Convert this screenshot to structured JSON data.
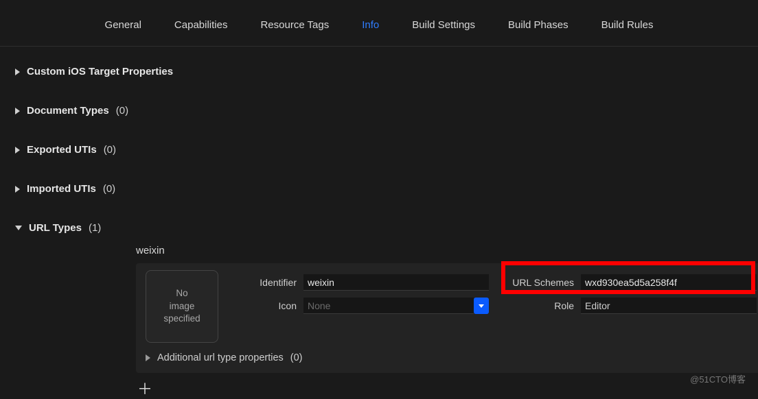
{
  "tabs": {
    "general": "General",
    "capabilities": "Capabilities",
    "resource_tags": "Resource Tags",
    "info": "Info",
    "build_settings": "Build Settings",
    "build_phases": "Build Phases",
    "build_rules": "Build Rules",
    "active": "info"
  },
  "sections": {
    "custom_props": {
      "label": "Custom iOS Target Properties"
    },
    "doc_types": {
      "label": "Document Types",
      "count": "(0)"
    },
    "exported_utis": {
      "label": "Exported UTIs",
      "count": "(0)"
    },
    "imported_utis": {
      "label": "Imported UTIs",
      "count": "(0)"
    },
    "url_types": {
      "label": "URL Types",
      "count": "(1)"
    }
  },
  "url_entry": {
    "name": "weixin",
    "img_well_text": "No\nimage\nspecified",
    "identifier_label": "Identifier",
    "identifier_value": "weixin",
    "icon_label": "Icon",
    "icon_value": "None",
    "url_schemes_label": "URL Schemes",
    "url_schemes_value": "wxd930ea5d5a258f4f",
    "role_label": "Role",
    "role_value": "Editor",
    "additional_label": "Additional url type properties",
    "additional_count": "(0)"
  },
  "watermark": "@51CTO博客"
}
